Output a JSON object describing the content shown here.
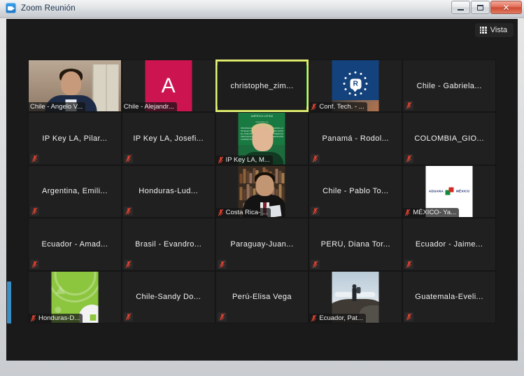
{
  "window": {
    "title": "Zoom Reunión",
    "app_icon": "zoom-camera-icon",
    "buttons": {
      "minimize": "–",
      "maximize": "❐",
      "close": "✕"
    }
  },
  "toolbar": {
    "view_label": "Vista",
    "view_icon": "grid-view-icon"
  },
  "gallery": {
    "columns": 5,
    "rows": 5,
    "active_speaker_border_color": "#e8ef7a",
    "active_speaker_accent_color": "#56c033",
    "scrollbar_thumb_color": "#3b8ec4",
    "participants": [
      {
        "name": "Chile - Angelo V...",
        "label_position": "badge",
        "muted": false,
        "video": true,
        "media": "office-man",
        "media_width": "wide",
        "active": false
      },
      {
        "name": "Chile - Alejandr...",
        "label_position": "badge",
        "muted": false,
        "video": false,
        "media": "initial-avatar",
        "initial": "A",
        "avatar_color": "#cc1450",
        "active": false
      },
      {
        "name": "christophe_zim...",
        "label_position": "center",
        "muted": false,
        "video": false,
        "media": "none",
        "active": true
      },
      {
        "name": "Conf. Tech. - ...",
        "label_position": "badge",
        "muted": true,
        "video": true,
        "media": "eu-logo",
        "active": false
      },
      {
        "name": "Chile - Gabriela...",
        "label_position": "center",
        "muted": true,
        "video": false,
        "media": "none",
        "active": false
      },
      {
        "name": "IP Key LA, Pilar...",
        "label_position": "center",
        "muted": true,
        "video": false,
        "media": "none",
        "active": false
      },
      {
        "name": "IP Key LA, Josefi...",
        "label_position": "center",
        "muted": true,
        "video": false,
        "media": "none",
        "active": false
      },
      {
        "name": "IP Key LA, M...",
        "label_position": "badge",
        "muted": true,
        "video": true,
        "media": "green-slide-man",
        "active": false
      },
      {
        "name": "Panamá - Rodol...",
        "label_position": "center",
        "muted": true,
        "video": false,
        "media": "none",
        "active": false
      },
      {
        "name": "COLOMBIA_GIO...",
        "label_position": "center",
        "muted": true,
        "video": false,
        "media": "none",
        "active": false
      },
      {
        "name": "Argentina, Emili...",
        "label_position": "center",
        "muted": true,
        "video": false,
        "media": "none",
        "active": false
      },
      {
        "name": "Honduras-Lud...",
        "label_position": "center",
        "muted": true,
        "video": false,
        "media": "none",
        "active": false
      },
      {
        "name": "Costa Rica- ...",
        "label_position": "badge",
        "muted": true,
        "video": true,
        "media": "bookshelf-man",
        "active": false
      },
      {
        "name": "Chile - Pablo To...",
        "label_position": "center",
        "muted": true,
        "video": false,
        "media": "none",
        "active": false
      },
      {
        "name": "MÉXICO- Ya...",
        "label_position": "badge",
        "muted": true,
        "video": true,
        "media": "aduana-mexico-logo",
        "active": false
      },
      {
        "name": "Ecuador - Amad...",
        "label_position": "center",
        "muted": true,
        "video": false,
        "media": "none",
        "active": false
      },
      {
        "name": "Brasil - Evandro...",
        "label_position": "center",
        "muted": true,
        "video": false,
        "media": "none",
        "active": false
      },
      {
        "name": "Paraguay-Juan...",
        "label_position": "center",
        "muted": true,
        "video": false,
        "media": "none",
        "active": false
      },
      {
        "name": "PERÚ, Diana Tor...",
        "label_position": "center",
        "muted": true,
        "video": false,
        "media": "none",
        "active": false
      },
      {
        "name": "Ecuador - Jaime...",
        "label_position": "center",
        "muted": true,
        "video": false,
        "media": "none",
        "active": false
      },
      {
        "name": "Honduras-D...",
        "label_position": "badge",
        "muted": true,
        "video": true,
        "media": "lime-avatar",
        "active": false
      },
      {
        "name": "Chile-Sandy  Do...",
        "label_position": "center",
        "muted": true,
        "video": false,
        "media": "none",
        "active": false
      },
      {
        "name": "Perú-Elisa Vega",
        "label_position": "center",
        "muted": true,
        "video": false,
        "media": "none",
        "active": false
      },
      {
        "name": "Ecuador, Pat...",
        "label_position": "badge",
        "muted": true,
        "video": true,
        "media": "hiker-photo",
        "active": false
      },
      {
        "name": "Guatemala-Eveli...",
        "label_position": "center",
        "muted": true,
        "video": false,
        "media": "none",
        "active": false
      }
    ]
  },
  "media_art": {
    "eu_logo_letter": "R",
    "aduana_left_text": "ADUANA",
    "aduana_right_text": "MÉXICO",
    "green_slide_title": "AMÉRICA LATINA",
    "green_slide_subtitle": "www.ipkey.eu",
    "green_slide_col_left": "PROPIEDAD INTELECTUAL\nEL CRECIMIENTO\nINNOVACIÓN Y\nCOMPETITIVIDAD",
    "green_slide_col_right": "DESARROLLO\nMERCADOS\nCOMERCIO\nCOOPERACIÓN"
  }
}
